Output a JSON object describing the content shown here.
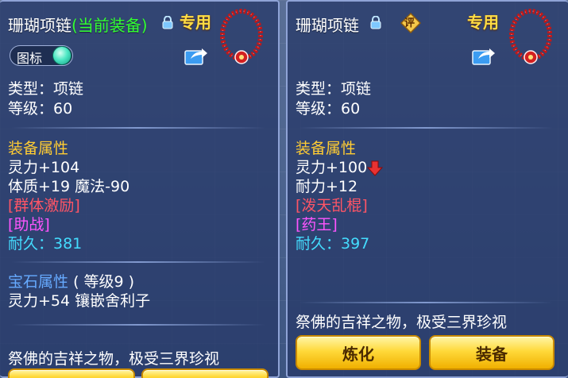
{
  "left_panel": {
    "title": "珊瑚项链",
    "title_note": "(当前装备)",
    "special": "专用",
    "toggle_label": "图标",
    "type_line": "类型：项链",
    "level_line": "等级：60",
    "attr_heading": "装备属性",
    "attrs": [
      "灵力+104",
      "体质+19 魔法-90"
    ],
    "special_skill": "[群体激励]",
    "special_effect": "[助战]",
    "durability": "耐久：381",
    "gem_heading": "宝石属性",
    "gem_level": "( 等级9 )",
    "gem_line": "灵力+54 镶嵌舍利子",
    "description": "祭佛的吉祥之物，极受三界珍视"
  },
  "right_panel": {
    "title": "珊瑚项链",
    "rating_badge": "评",
    "special": "专用",
    "type_line": "类型：项链",
    "level_line": "等级：60",
    "attr_heading": "装备属性",
    "attrs": [
      "灵力+100",
      "耐力+12"
    ],
    "special_skill": "[泼天乱棍]",
    "special_effect": "[药王]",
    "durability": "耐久：397",
    "description": "祭佛的吉祥之物，极受三界珍视",
    "buttons": {
      "refine": "炼化",
      "equip": "装备"
    }
  },
  "colors": {
    "title": "#ffffff",
    "current_tag": "#33ff33",
    "special": "#ffdd44",
    "heading": "#ffcc33",
    "skill": "#ff5566",
    "effect": "#ff55ff",
    "durability": "#44ddff",
    "gem": "#66aaff",
    "button": "#ffd93a"
  }
}
